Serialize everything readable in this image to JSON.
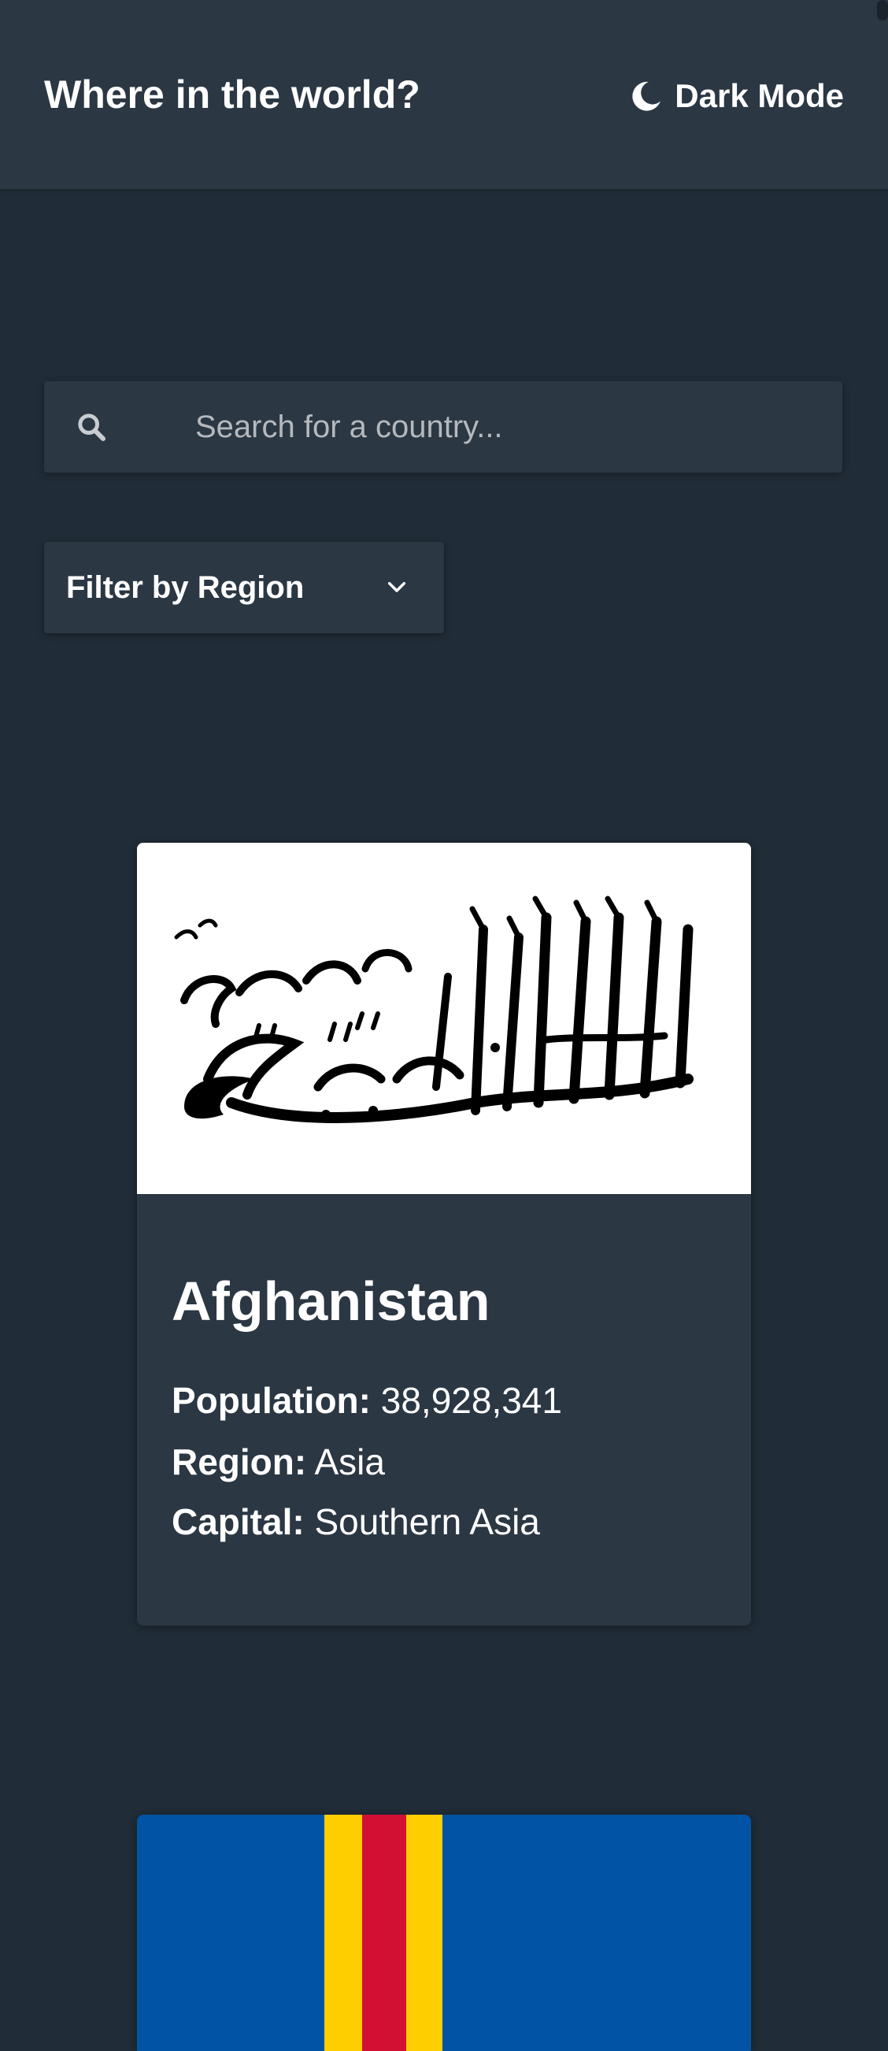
{
  "header": {
    "title": "Where in the world?",
    "theme_toggle_label": "Dark Mode",
    "theme_icon": "moon-icon"
  },
  "search": {
    "placeholder": "Search for a country...",
    "value": "",
    "icon": "search-icon"
  },
  "filter": {
    "label": "Filter by Region",
    "icon": "chevron-down-icon"
  },
  "countries": [
    {
      "name": "Afghanistan",
      "flag_icon": "afghanistan-flag-icon",
      "population_label": "Population:",
      "population": "38,928,341",
      "region_label": "Region:",
      "region": "Asia",
      "capital_label": "Capital:",
      "capital": "Southern Asia"
    },
    {
      "flag_icon": "aland-islands-flag-icon"
    }
  ],
  "colors": {
    "background": "#202c37",
    "elements": "#2b3743",
    "text": "#ffffff",
    "placeholder": "#b5b9be",
    "aland_blue": "#0053a5",
    "aland_yellow": "#ffce00",
    "aland_red": "#d21034"
  }
}
